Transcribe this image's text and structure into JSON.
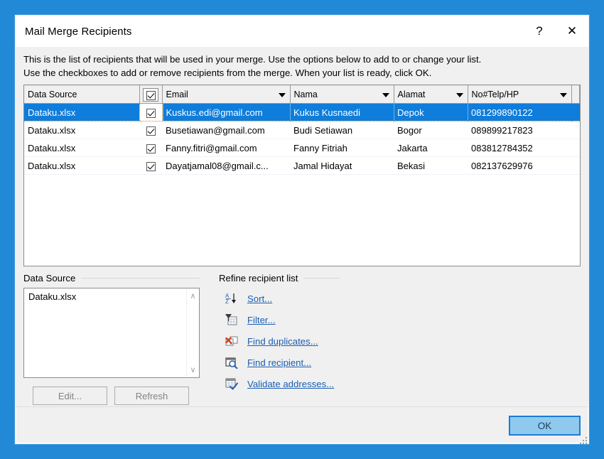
{
  "window": {
    "title": "Mail Merge Recipients",
    "help_glyph": "?",
    "close_glyph": "✕"
  },
  "description": {
    "line1": "This is the list of recipients that will be used in your merge.  Use the options below to add to or change your list.",
    "line2": "Use the checkboxes to add or remove recipients from the merge.  When your list is ready, click OK."
  },
  "grid": {
    "columns": [
      {
        "label": "Data Source",
        "has_arrow": false
      },
      {
        "label": "",
        "has_arrow": false
      },
      {
        "label": "Email",
        "has_arrow": true
      },
      {
        "label": "Nama",
        "has_arrow": true
      },
      {
        "label": "Alamat",
        "has_arrow": true
      },
      {
        "label": "No#Telp/HP",
        "has_arrow": true
      }
    ],
    "header_checkbox_checked": true,
    "rows": [
      {
        "selected": true,
        "data_source": "Dataku.xlsx",
        "checked": true,
        "email": "Kuskus.edi@gmail.com",
        "nama": "Kukus Kusnaedi",
        "alamat": "Depok",
        "telp": "081299890122"
      },
      {
        "selected": false,
        "data_source": "Dataku.xlsx",
        "checked": true,
        "email": "Busetiawan@gmail.com",
        "nama": "Budi Setiawan",
        "alamat": "Bogor",
        "telp": "089899217823"
      },
      {
        "selected": false,
        "data_source": "Dataku.xlsx",
        "checked": true,
        "email": "Fanny.fitri@gmail.com",
        "nama": "Fanny Fitriah",
        "alamat": "Jakarta",
        "telp": "083812784352"
      },
      {
        "selected": false,
        "data_source": "Dataku.xlsx",
        "checked": true,
        "email": "Dayatjamal08@gmail.c...",
        "nama": "Jamal Hidayat",
        "alamat": "Bekasi",
        "telp": "082137629976"
      }
    ]
  },
  "data_source_panel": {
    "title": "Data Source",
    "items": [
      "Dataku.xlsx"
    ],
    "scroll_up_glyph": "∧",
    "scroll_down_glyph": "∨",
    "edit_button": "Edit...",
    "refresh_button": "Refresh"
  },
  "refine_panel": {
    "title": "Refine recipient list",
    "items": [
      {
        "label": "Sort...",
        "icon": "sort-az-icon"
      },
      {
        "label": "Filter...",
        "icon": "filter-funnel-icon"
      },
      {
        "label": "Find duplicates...",
        "icon": "find-duplicates-icon"
      },
      {
        "label": "Find recipient...",
        "icon": "find-recipient-magnifier-icon"
      },
      {
        "label": "Validate addresses...",
        "icon": "validate-addresses-check-icon"
      }
    ]
  },
  "footer": {
    "ok_label": "OK"
  },
  "colors": {
    "desktop_blue": "#2289d6",
    "selection_blue": "#0f7ddb",
    "link_blue": "#1a5fb4",
    "ok_fill": "#8fcaee",
    "ok_border": "#1a7bd4"
  }
}
